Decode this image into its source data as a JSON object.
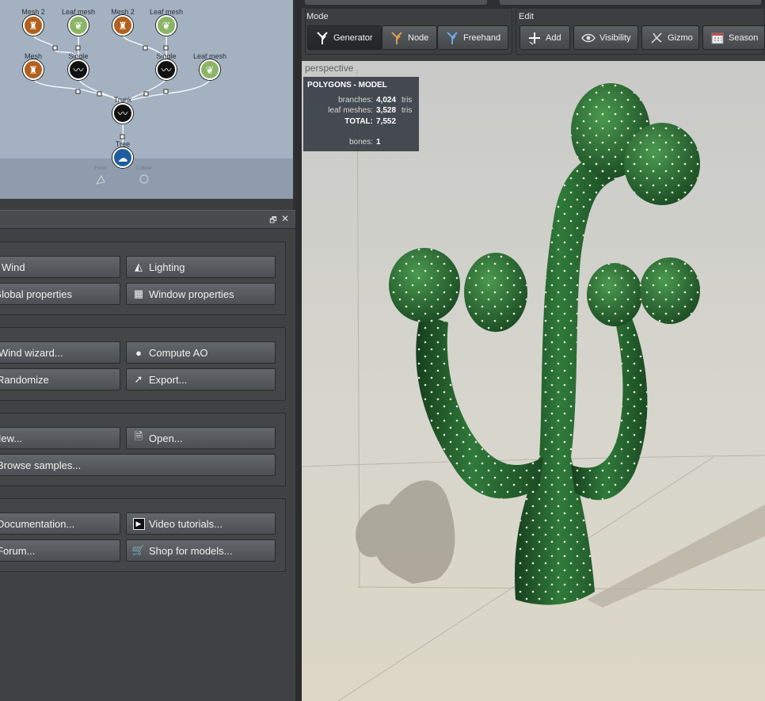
{
  "graph": {
    "nodes": [
      {
        "label": "Mesh 2",
        "kind": "mesh"
      },
      {
        "label": "Leaf mesh",
        "kind": "leaf"
      },
      {
        "label": "Mesh 2",
        "kind": "mesh"
      },
      {
        "label": "Leaf mesh",
        "kind": "leaf"
      },
      {
        "label": "Mesh",
        "kind": "mesh"
      },
      {
        "label": "Single",
        "kind": "single"
      },
      {
        "label": "Single",
        "kind": "single"
      },
      {
        "label": "Leaf mesh",
        "kind": "leaf"
      },
      {
        "label": "Trunk",
        "kind": "trunk"
      },
      {
        "label": "Tree",
        "kind": "tree"
      }
    ],
    "ghost_labels": [
      "Force",
      "Collider"
    ]
  },
  "left_panel": {
    "controls": {
      "restore": "🗗",
      "close": "✕"
    },
    "groups": [
      {
        "buttons": [
          {
            "label": "Wind",
            "icon": "wind-icon"
          },
          {
            "label": "Lighting",
            "icon": "lamp-icon"
          },
          {
            "label": "Global properties",
            "icon": "globe-icon"
          },
          {
            "label": "Window properties",
            "icon": "window-grid-icon"
          }
        ]
      },
      {
        "buttons": [
          {
            "label": "Wind wizard...",
            "icon": "wand-icon"
          },
          {
            "label": "Compute AO",
            "icon": "sphere-icon"
          },
          {
            "label": "Randomize",
            "icon": "dice-icon"
          },
          {
            "label": "Export...",
            "icon": "export-arrow-icon"
          }
        ]
      },
      {
        "buttons": [
          {
            "label": "New...",
            "icon": "new-file-icon"
          },
          {
            "label": "Open...",
            "icon": "open-file-icon"
          },
          {
            "label": "Browse samples...",
            "icon": "folder-icon"
          }
        ]
      },
      {
        "buttons": [
          {
            "label": "Documentation...",
            "icon": "book-icon"
          },
          {
            "label": "Video tutorials...",
            "icon": "play-icon"
          },
          {
            "label": "Forum...",
            "icon": "chat-icon"
          },
          {
            "label": "Shop for models...",
            "icon": "cart-icon"
          }
        ]
      }
    ]
  },
  "toolbar": {
    "mode_label": "Mode",
    "edit_label": "Edit",
    "mode_buttons": [
      {
        "label": "Generator",
        "icon": "branch-white-icon",
        "active": true
      },
      {
        "label": "Node",
        "icon": "branch-orange-icon",
        "active": false
      },
      {
        "label": "Freehand",
        "icon": "branch-blue-icon",
        "active": false
      }
    ],
    "edit_buttons": [
      {
        "label": "Add",
        "icon": "add-plus-icon"
      },
      {
        "label": "Visibility",
        "icon": "visibility-icon"
      },
      {
        "label": "Gizmo",
        "icon": "gizmo-icon"
      },
      {
        "label": "Season",
        "icon": "calendar-icon"
      }
    ]
  },
  "viewport": {
    "view_name": "perspective",
    "stats": {
      "heading": "POLYGONS - MODEL",
      "rows": [
        {
          "label": "branches:",
          "value": "4,024",
          "unit": "tris"
        },
        {
          "label": "leaf meshes:",
          "value": "3,528",
          "unit": "tris"
        },
        {
          "label": "TOTAL:",
          "value": "7,552",
          "unit": ""
        },
        {
          "label": "bones:",
          "value": "1",
          "unit": ""
        }
      ]
    },
    "colors": {
      "cactus_dark": "#1f5a2a",
      "cactus_mid": "#2f7a3a",
      "cactus_light": "#4f9b55",
      "spine": "#f4f1dc",
      "shadow": "#9f9a8e"
    }
  }
}
